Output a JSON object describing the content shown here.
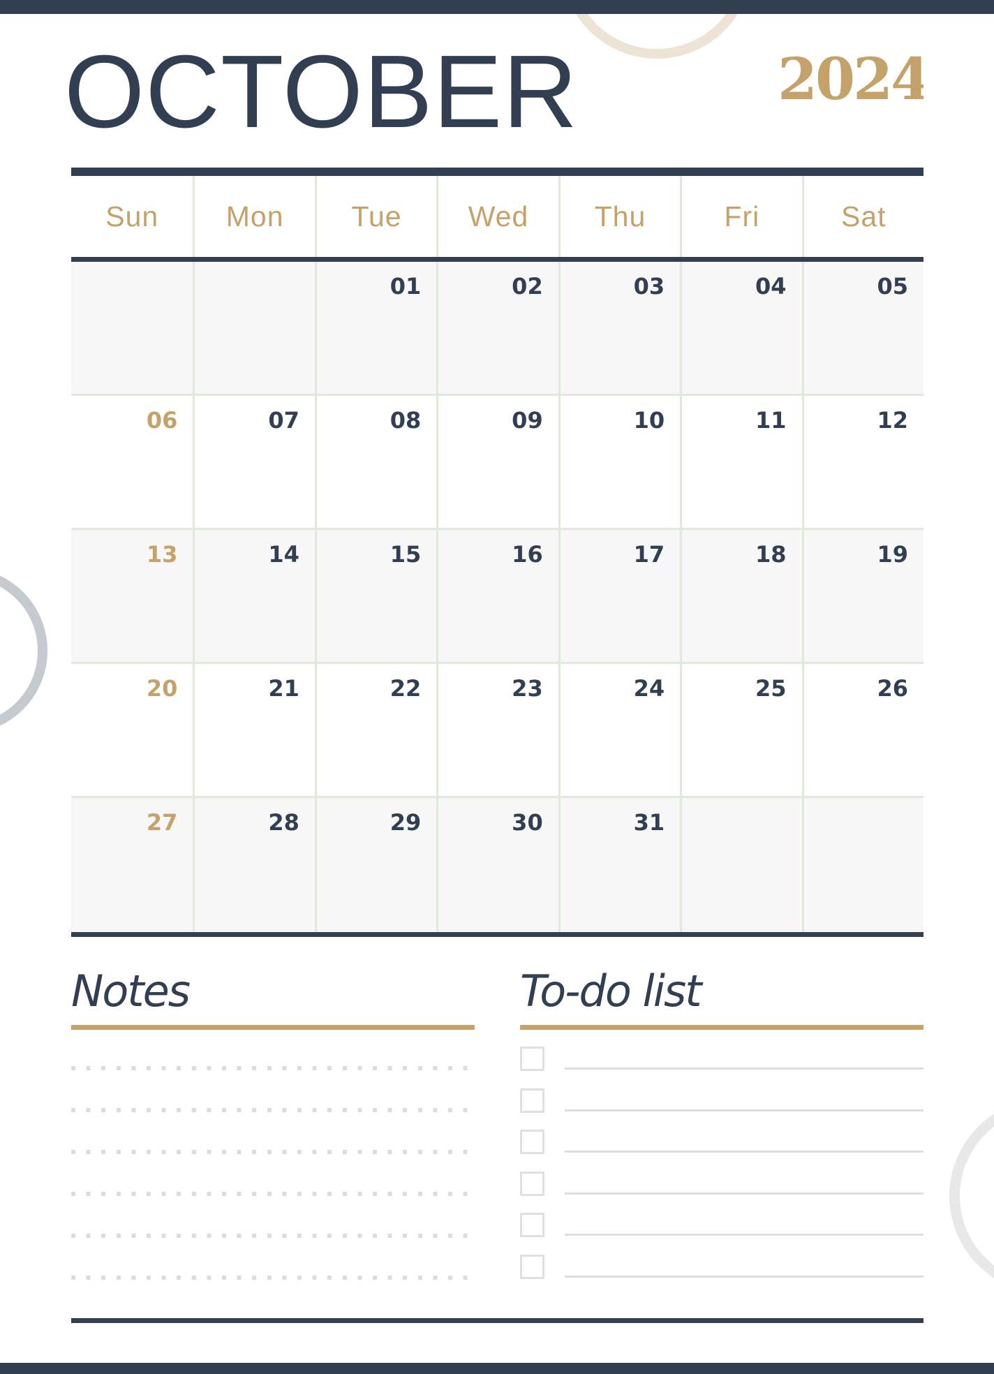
{
  "header": {
    "month": "OCTOBER",
    "year": "2024"
  },
  "calendar": {
    "weekdays": [
      "Sun",
      "Mon",
      "Tue",
      "Wed",
      "Thu",
      "Fri",
      "Sat"
    ],
    "weeks": [
      [
        "",
        "",
        "01",
        "02",
        "03",
        "04",
        "05"
      ],
      [
        "06",
        "07",
        "08",
        "09",
        "10",
        "11",
        "12"
      ],
      [
        "13",
        "14",
        "15",
        "16",
        "17",
        "18",
        "19"
      ],
      [
        "20",
        "21",
        "22",
        "23",
        "24",
        "25",
        "26"
      ],
      [
        "27",
        "28",
        "29",
        "30",
        "31",
        "",
        ""
      ]
    ]
  },
  "notes": {
    "title": "Notes",
    "line_count": 6
  },
  "todo": {
    "title": "To-do list",
    "items": [
      {
        "checked": false,
        "text": ""
      },
      {
        "checked": false,
        "text": ""
      },
      {
        "checked": false,
        "text": ""
      },
      {
        "checked": false,
        "text": ""
      },
      {
        "checked": false,
        "text": ""
      },
      {
        "checked": false,
        "text": ""
      }
    ]
  },
  "colors": {
    "navy": "#323f52",
    "gold": "#c4a26a",
    "grid_line": "#dfe9dc",
    "shaded_row": "#f7f7f7"
  }
}
